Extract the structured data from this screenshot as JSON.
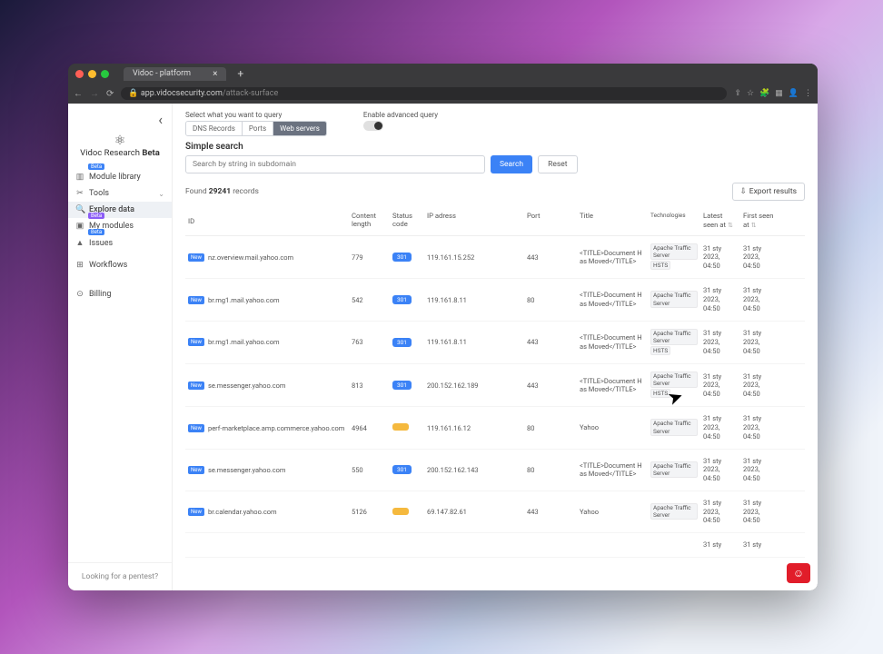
{
  "browser": {
    "tab_title": "Vidoc - platform",
    "url_host": "app.vidocsecurity.com",
    "url_path": "/attack-surface"
  },
  "brand": {
    "name": "Vidoc Research",
    "tag": "Beta"
  },
  "sidebar": {
    "items": [
      {
        "label": "Module library",
        "icon": "library",
        "badge": "Beta"
      },
      {
        "label": "Tools",
        "icon": "wrench",
        "chevron": true
      },
      {
        "label": "Explore data",
        "icon": "search",
        "active": true
      },
      {
        "label": "My modules",
        "icon": "box",
        "badge": "Beta",
        "badge_color": "purple"
      },
      {
        "label": "Issues",
        "icon": "shield",
        "badge": "Beta"
      },
      {
        "label": "Workflows",
        "icon": "flow"
      },
      {
        "label": "Billing",
        "icon": "billing"
      }
    ],
    "footer": "Looking for a pentest?"
  },
  "query": {
    "select_label": "Select what you want to query",
    "segments": [
      "DNS Records",
      "Ports",
      "Web servers"
    ],
    "active_segment": 2,
    "advanced_label": "Enable advanced query"
  },
  "search": {
    "heading": "Simple search",
    "placeholder": "Search by string in subdomain",
    "search_btn": "Search",
    "reset_btn": "Reset"
  },
  "results": {
    "found_prefix": "Found ",
    "count": "29241",
    "found_suffix": " records",
    "export": "Export results"
  },
  "columns": {
    "id": "ID",
    "clen": "Content length",
    "status": "Status code",
    "ip": "IP adress",
    "port": "Port",
    "title": "Title",
    "tech": "Technologies",
    "latest": "Latest seen at",
    "first": "First seen at"
  },
  "badge_new": "New",
  "rows": [
    {
      "host": "nz.overview.mail.yahoo.com",
      "clen": "779",
      "status": "301",
      "ip": "119.161.15.252",
      "port": "443",
      "title": "<TITLE>Document Has Moved</TITLE>",
      "tech": [
        "Apache Traffic Server",
        "HSTS"
      ],
      "latest": "31 sty 2023, 04:50",
      "first": "31 sty 2023, 04:50"
    },
    {
      "host": "br.mg1.mail.yahoo.com",
      "clen": "542",
      "status": "301",
      "ip": "119.161.8.11",
      "port": "80",
      "title": "<TITLE>Document Has Moved</TITLE>",
      "tech": [
        "Apache Traffic Server"
      ],
      "latest": "31 sty 2023, 04:50",
      "first": "31 sty 2023, 04:50"
    },
    {
      "host": "br.mg1.mail.yahoo.com",
      "clen": "763",
      "status": "301",
      "ip": "119.161.8.11",
      "port": "443",
      "title": "<TITLE>Document Has Moved</TITLE>",
      "tech": [
        "Apache Traffic Server",
        "HSTS"
      ],
      "latest": "31 sty 2023, 04:50",
      "first": "31 sty 2023, 04:50"
    },
    {
      "host": "se.messenger.yahoo.com",
      "clen": "813",
      "status": "301",
      "ip": "200.152.162.189",
      "port": "443",
      "title": "<TITLE>Document Has Moved</TITLE>",
      "tech": [
        "Apache Traffic Server",
        "HSTS"
      ],
      "latest": "31 sty 2023, 04:50",
      "first": "31 sty 2023, 04:50"
    },
    {
      "host": "perf-marketplace.amp.commerce.yahoo.com",
      "clen": "4964",
      "status": "",
      "ip": "119.161.16.12",
      "port": "80",
      "title": "Yahoo",
      "tech": [
        "Apache Traffic Server"
      ],
      "latest": "31 sty 2023, 04:50",
      "first": "31 sty 2023, 04:50"
    },
    {
      "host": "se.messenger.yahoo.com",
      "clen": "550",
      "status": "301",
      "ip": "200.152.162.143",
      "port": "80",
      "title": "<TITLE>Document Has Moved</TITLE>",
      "tech": [
        "Apache Traffic Server"
      ],
      "latest": "31 sty 2023, 04:50",
      "first": "31 sty 2023, 04:50"
    },
    {
      "host": "br.calendar.yahoo.com",
      "clen": "5126",
      "status": "",
      "ip": "69.147.82.61",
      "port": "443",
      "title": "Yahoo",
      "tech": [
        "Apache Traffic Server"
      ],
      "latest": "31 sty 2023, 04:50",
      "first": "31 sty 2023, 04:50"
    },
    {
      "host": "",
      "clen": "",
      "status": "",
      "ip": "",
      "port": "",
      "title": "",
      "tech": [],
      "latest": "31 sty",
      "first": "31 sty"
    }
  ]
}
